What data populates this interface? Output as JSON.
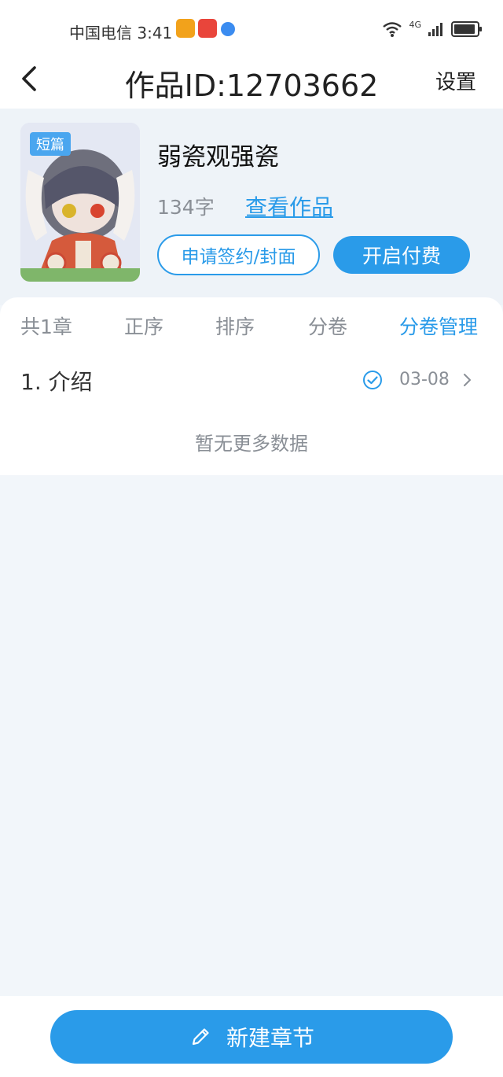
{
  "status_bar": {
    "carrier_time": "中国电信 3:41",
    "network": "4G"
  },
  "header": {
    "title": "作品ID:12703662",
    "settings_label": "设置"
  },
  "work": {
    "badge": "短篇",
    "title": "弱瓷观强瓷",
    "word_count": "134字",
    "view_link": "查看作品",
    "apply_button": "申请签约/封面",
    "pay_button": "开启付费"
  },
  "tabs": {
    "total": "共1章",
    "order": "正序",
    "sort": "排序",
    "volume": "分卷",
    "volume_manage": "分卷管理"
  },
  "chapters": [
    {
      "name": "1. 介绍",
      "date": "03-08",
      "checked": true
    }
  ],
  "empty_text": "暂无更多数据",
  "bottom": {
    "new_chapter_label": "新建章节"
  },
  "colors": {
    "accent": "#2a9be9",
    "background": "#f2f6fa"
  }
}
